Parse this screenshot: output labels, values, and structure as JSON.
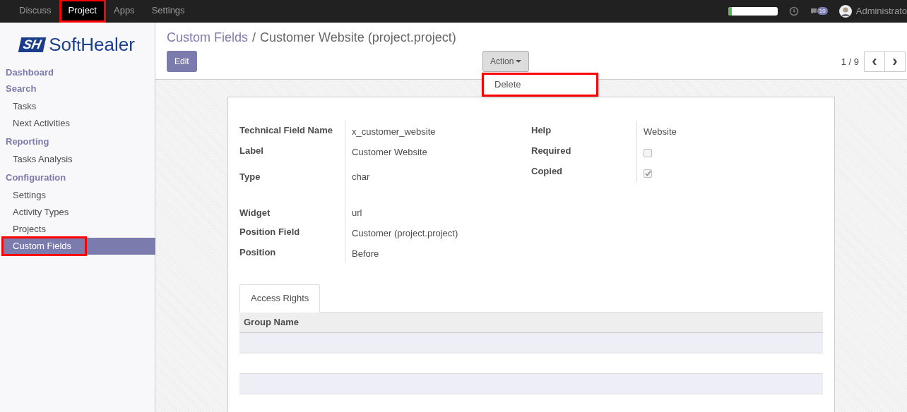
{
  "top_menu": [
    {
      "label": "Discuss",
      "selected": false,
      "highlighted": false
    },
    {
      "label": "Project",
      "selected": true,
      "highlighted": true
    },
    {
      "label": "Apps",
      "selected": false,
      "highlighted": false
    },
    {
      "label": "Settings",
      "selected": false,
      "highlighted": false
    }
  ],
  "systray": {
    "level": 0.07,
    "message_count": "10",
    "user": "Administrato"
  },
  "logo": {
    "mark": "SH",
    "name_start": "Sof",
    "name_t": "t",
    "name_end": "Healer"
  },
  "sidebar": [
    {
      "heading": "Dashboard"
    },
    {
      "heading": "Search",
      "items": [
        {
          "label": "Tasks",
          "selected": false,
          "highlighted": false
        },
        {
          "label": "Next Activities",
          "selected": false,
          "highlighted": false
        }
      ]
    },
    {
      "heading": "Reporting",
      "items": [
        {
          "label": "Tasks Analysis",
          "selected": false,
          "highlighted": false
        }
      ]
    },
    {
      "heading": "Configuration",
      "items": [
        {
          "label": "Settings",
          "selected": false,
          "highlighted": false
        },
        {
          "label": "Activity Types",
          "selected": false,
          "highlighted": false
        },
        {
          "label": "Projects",
          "selected": false,
          "highlighted": false
        },
        {
          "label": "Custom Fields",
          "selected": true,
          "highlighted": true
        }
      ]
    }
  ],
  "breadcrumb": {
    "parent": "Custom Fields",
    "separator": "/",
    "current": "Customer Website (project.project)"
  },
  "edit_button": "Edit",
  "action": {
    "label": "Action",
    "menu": [
      {
        "label": "Delete",
        "highlighted": true
      }
    ]
  },
  "pager": {
    "text": "1 / 9",
    "prev": "‹",
    "next": "›"
  },
  "left_fields": [
    {
      "label": "Technical Field Name",
      "value": "x_customer_website"
    },
    {
      "label": "Label",
      "value": "Customer Website"
    },
    {
      "label": "Type",
      "value": "char"
    },
    {
      "label": "Widget",
      "value": "url"
    },
    {
      "label": "Position Field",
      "value": "Customer (project.project)"
    },
    {
      "label": "Position",
      "value": "Before"
    }
  ],
  "right_fields": [
    {
      "label": "Help",
      "kind": "text",
      "value": "Website"
    },
    {
      "label": "Required",
      "kind": "checkbox",
      "checked": false
    },
    {
      "label": "Copied",
      "kind": "checkbox",
      "checked": true
    }
  ],
  "tabs": [
    {
      "label": "Access Rights",
      "selected": true
    }
  ],
  "table": {
    "columns": [
      "Group Name"
    ]
  }
}
